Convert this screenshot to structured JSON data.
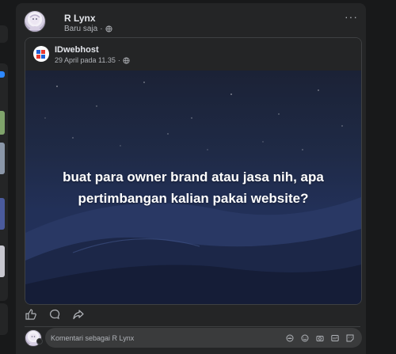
{
  "post": {
    "author": "R Lynx",
    "time": "Baru saja",
    "more_label": "···",
    "shared": {
      "page_name": "IDwebhost",
      "date": "29 April pada 11.35",
      "caption": "buat para owner brand atau jasa nih, apa pertimbangan kalian pakai website?"
    },
    "actions": [
      {
        "icon": "like-icon"
      },
      {
        "icon": "comment-icon"
      },
      {
        "icon": "share-icon"
      }
    ]
  },
  "comment_box": {
    "placeholder": "Komentari sebagai R Lynx",
    "icons": [
      "avatar-sticker-icon",
      "emoji-icon",
      "camera-icon",
      "gif-icon",
      "sticker-icon"
    ]
  },
  "colors": {
    "background": "#18191a",
    "card": "#242526",
    "text_primary": "#e4e6eb",
    "text_secondary": "#b0b3b8",
    "input": "#3a3b3c"
  }
}
